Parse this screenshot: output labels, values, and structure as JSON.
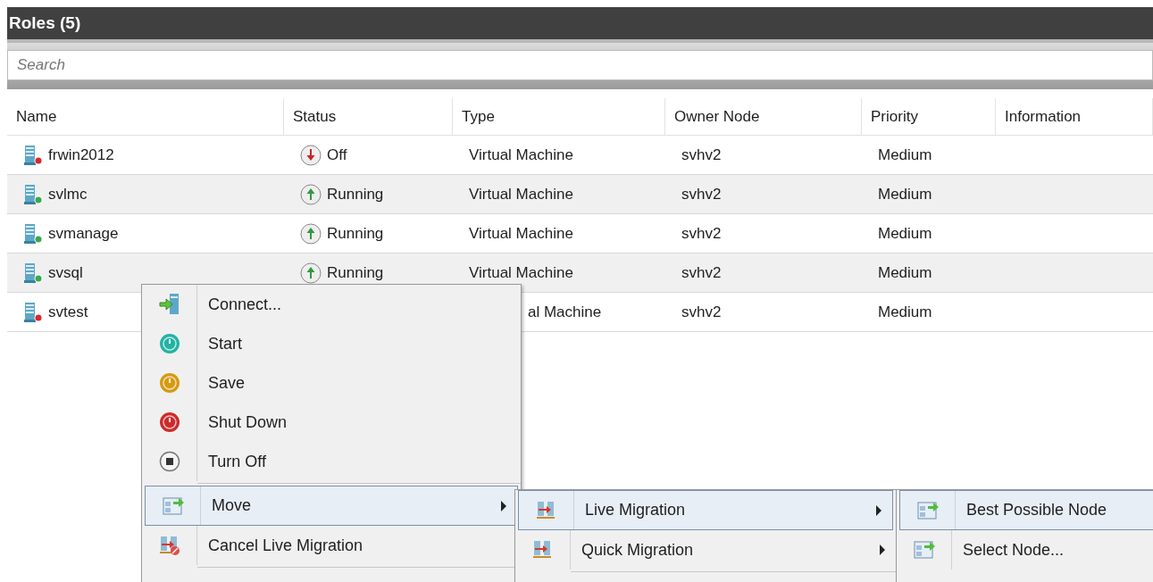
{
  "panel": {
    "title": "Roles (5)"
  },
  "search": {
    "placeholder": "Search"
  },
  "table": {
    "columns": [
      "Name",
      "Status",
      "Type",
      "Owner Node",
      "Priority",
      "Information"
    ],
    "rows": [
      {
        "name": "frwin2012",
        "kind": "off",
        "status": "Off",
        "type": "Virtual Machine",
        "owner": "svhv2",
        "priority": "Medium"
      },
      {
        "name": "svlmc",
        "kind": "running",
        "status": "Running",
        "type": "Virtual Machine",
        "owner": "svhv2",
        "priority": "Medium"
      },
      {
        "name": "svmanage",
        "kind": "running",
        "status": "Running",
        "type": "Virtual Machine",
        "owner": "svhv2",
        "priority": "Medium"
      },
      {
        "name": "svsql",
        "kind": "running",
        "status": "Running",
        "type": "Virtual Machine",
        "owner": "svhv2",
        "priority": "Medium"
      },
      {
        "name": "svtest",
        "kind": "off",
        "type": "al Machine",
        "owner": "svhv2",
        "priority": "Medium"
      }
    ]
  },
  "context_menu": {
    "items": [
      {
        "kind": "connect",
        "label": "Connect...",
        "highlighted": false,
        "submenu": false
      },
      {
        "kind": "start",
        "label": "Start",
        "highlighted": false,
        "submenu": false
      },
      {
        "kind": "save",
        "label": "Save",
        "highlighted": false,
        "submenu": false
      },
      {
        "kind": "shutdown",
        "label": "Shut Down",
        "highlighted": false,
        "submenu": false
      },
      {
        "kind": "turnoff",
        "label": "Turn Off",
        "highlighted": false,
        "submenu": false
      },
      {
        "kind": "separator"
      },
      {
        "kind": "move",
        "label": "Move",
        "highlighted": true,
        "submenu": true
      },
      {
        "kind": "cancel",
        "label": "Cancel Live Migration",
        "highlighted": false,
        "submenu": false
      },
      {
        "kind": "separator"
      }
    ]
  },
  "move_submenu": {
    "items": [
      {
        "kind": "migrate",
        "label": "Live Migration",
        "highlighted": true,
        "submenu": true
      },
      {
        "kind": "migrate",
        "label": "Quick Migration",
        "highlighted": false,
        "submenu": true
      },
      {
        "kind": "separator"
      }
    ]
  },
  "node_submenu": {
    "items": [
      {
        "kind": "node",
        "label": "Best Possible Node",
        "highlighted": true,
        "submenu": false
      },
      {
        "kind": "node",
        "label": "Select Node...",
        "highlighted": false,
        "submenu": false
      }
    ]
  }
}
